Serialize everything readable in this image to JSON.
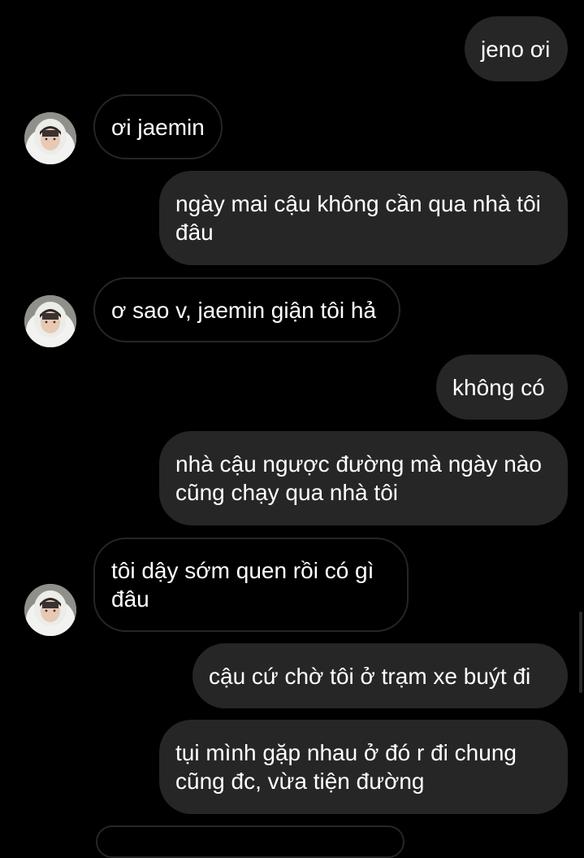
{
  "chat": {
    "messages": [
      {
        "id": "m1",
        "direction": "sent",
        "text": "jeno ơi"
      },
      {
        "id": "m2",
        "direction": "received",
        "text": "ơi jaemin"
      },
      {
        "id": "m3",
        "direction": "sent",
        "text": "ngày mai cậu không cần qua nhà tôi đâu"
      },
      {
        "id": "m4",
        "direction": "received",
        "text": "ơ sao v, jaemin giận tôi hả"
      },
      {
        "id": "m5",
        "direction": "sent",
        "text": "không có"
      },
      {
        "id": "m6",
        "direction": "sent",
        "text": "nhà cậu ngược đường mà ngày nào cũng chạy qua nhà tôi"
      },
      {
        "id": "m7",
        "direction": "received",
        "text": "tôi dậy sớm quen rồi có gì đâu"
      },
      {
        "id": "m8",
        "direction": "sent",
        "text": "cậu cứ chờ tôi ở trạm xe buýt đi"
      },
      {
        "id": "m9",
        "direction": "sent",
        "text": "tụi mình gặp nhau ở đó r đi chung cũng đc, vừa tiện đường"
      }
    ]
  },
  "colors": {
    "background": "#000000",
    "sent_bubble": "#262626",
    "received_border": "#262626",
    "text": "#ffffff"
  },
  "icons": {
    "avatar": "contact-avatar"
  }
}
